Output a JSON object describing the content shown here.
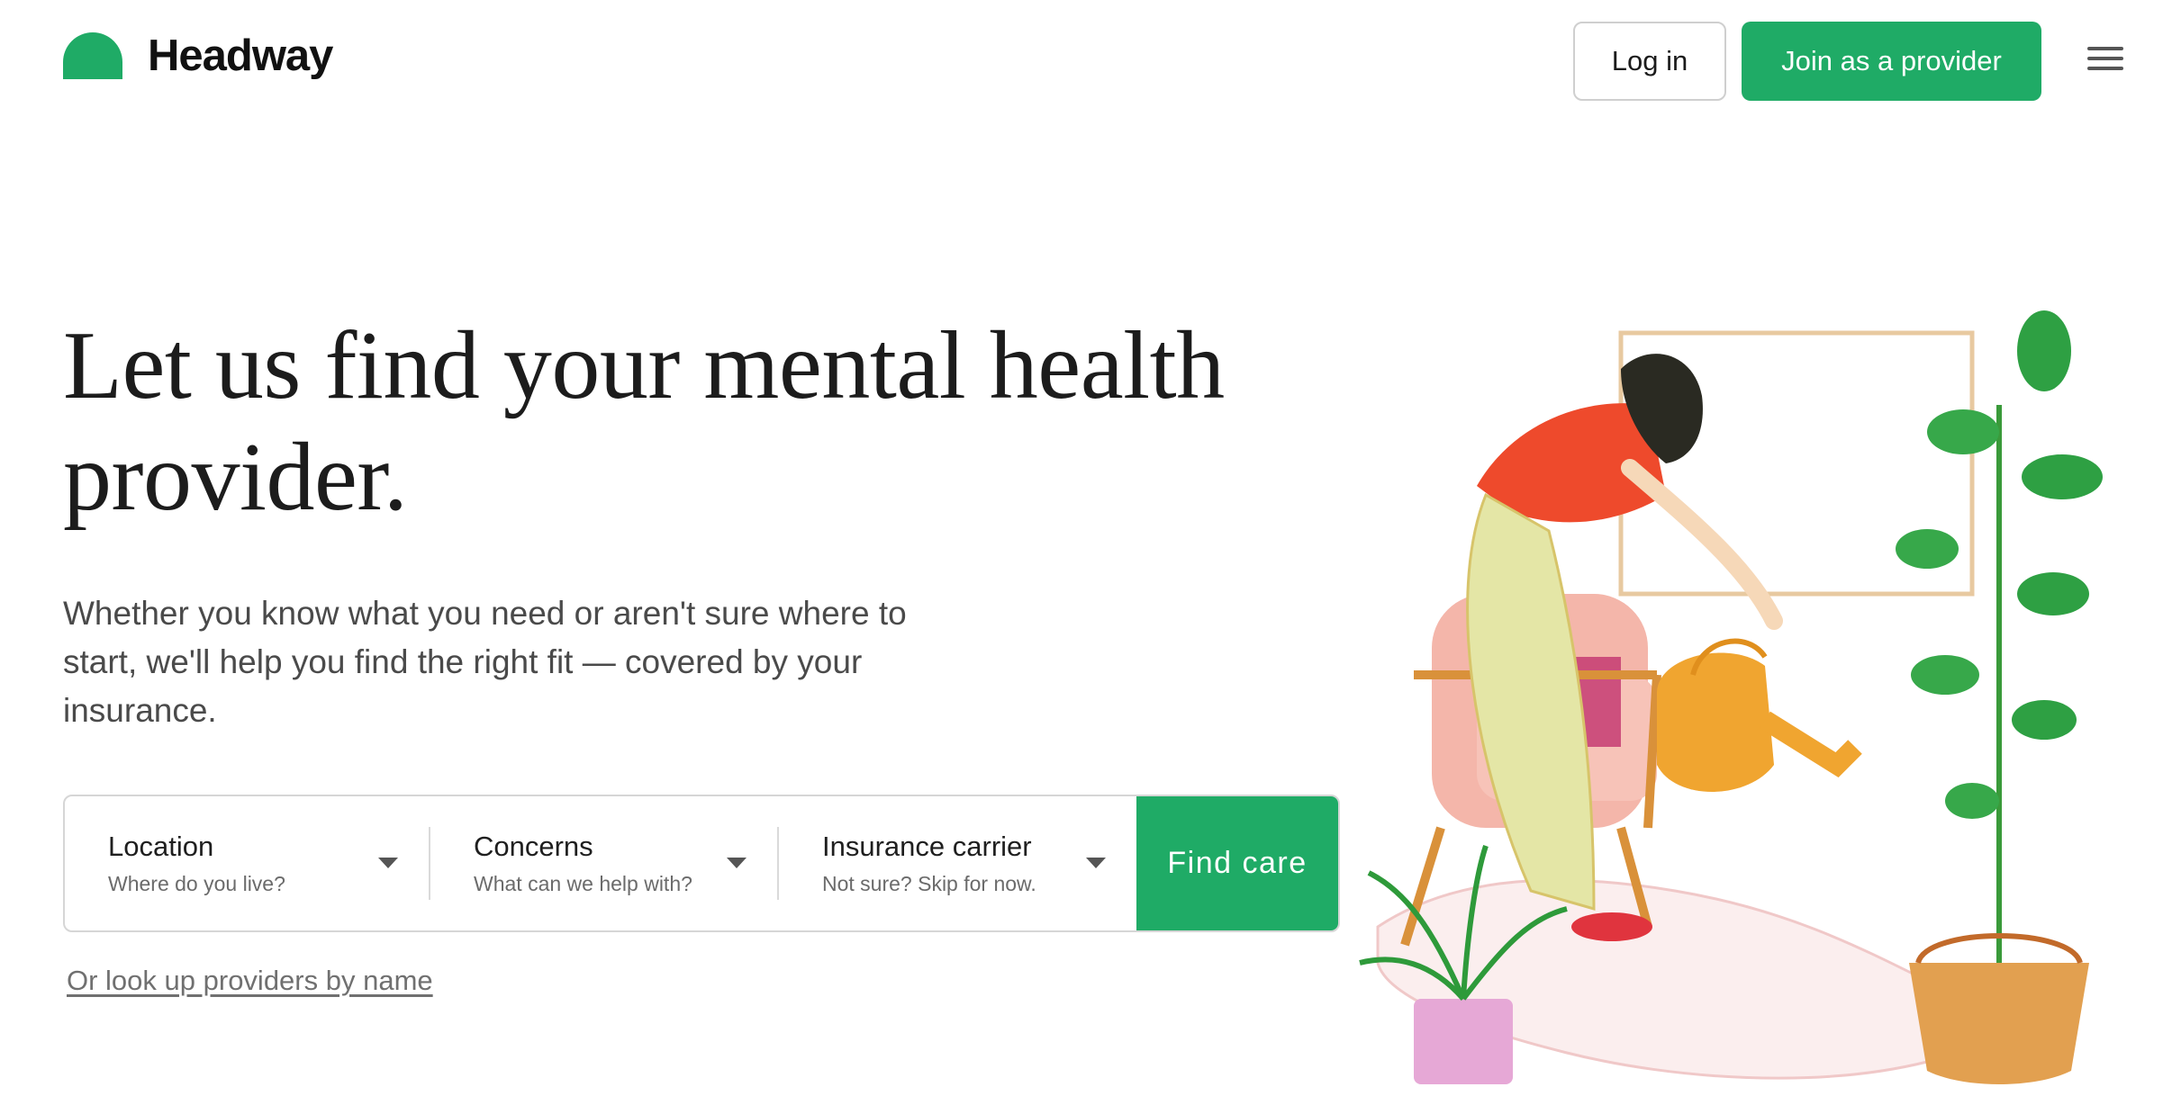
{
  "header": {
    "brand": "Headway",
    "login_label": "Log in",
    "join_label": "Join as a provider"
  },
  "hero": {
    "title": "Let us find your mental health provider.",
    "subtitle": "Whether you know what you need or aren't sure where to start, we'll help you find the right fit — covered by your insurance."
  },
  "search": {
    "location": {
      "label": "Location",
      "hint": "Where do you live?"
    },
    "concerns": {
      "label": "Concerns",
      "hint": "What can we help with?"
    },
    "insurance": {
      "label": "Insurance carrier",
      "hint": "Not sure? Skip for now."
    },
    "submit_label": "Find care"
  },
  "lookup_link": "Or look up providers by name",
  "colors": {
    "brand_green": "#1fab66",
    "text_dark": "#1c1c1c",
    "text_muted": "#4a4a4a"
  },
  "icons": {
    "logo": "headway-logo-icon",
    "menu": "hamburger-menu-icon",
    "dropdown": "chevron-down-icon"
  }
}
